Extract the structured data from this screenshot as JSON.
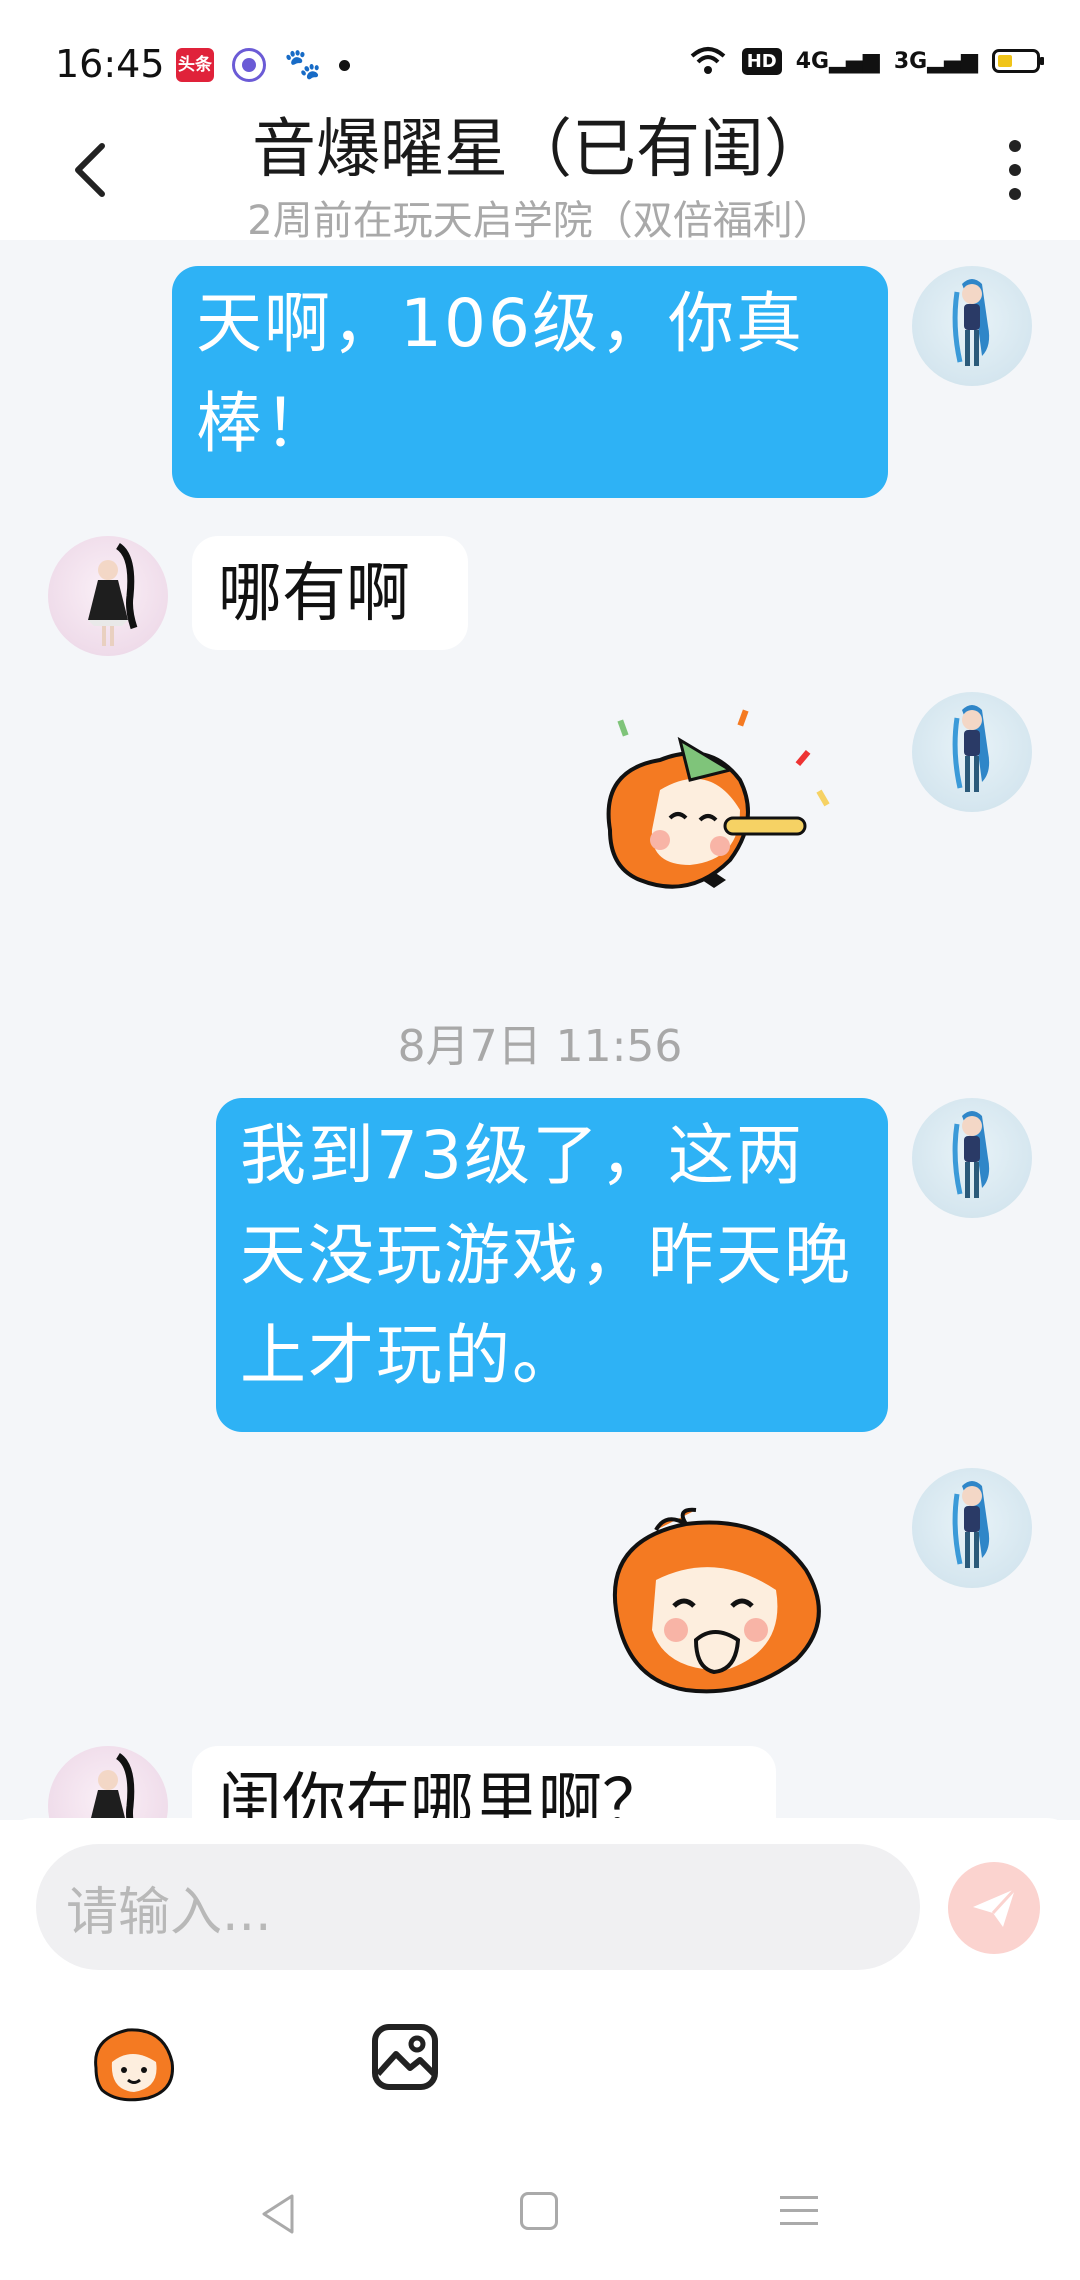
{
  "status_bar": {
    "time": "16:45",
    "app_toutiao_label": "头条",
    "net_4g": "4G",
    "net_3g": "3G",
    "hd_label": "HD",
    "battery_color": "#f0c419"
  },
  "header": {
    "title": "音爆曜星（已有闺）",
    "subtitle": "2周前在玩天启学院（双倍福利）"
  },
  "messages": [
    {
      "from": "me",
      "type": "text",
      "text": "天啊，106级，你真棒！"
    },
    {
      "from": "other",
      "type": "text",
      "text": "哪有啊"
    },
    {
      "from": "me",
      "type": "sticker",
      "sticker": "party-blower-sticker"
    },
    {
      "type": "timestamp",
      "text": "8月7日 11:56"
    },
    {
      "from": "me",
      "type": "text",
      "text": "我到73级了，这两天没玩游戏，昨天晚上才玩的。"
    },
    {
      "from": "me",
      "type": "sticker",
      "sticker": "laughing-cover-mouth-sticker"
    },
    {
      "from": "other",
      "type": "text",
      "text": "闺你在哪里啊？"
    }
  ],
  "input": {
    "placeholder": "请输入..."
  },
  "colors": {
    "my_bubble": "#2eb2f5",
    "other_bubble": "#ffffff",
    "chat_bg": "#f4f6f9",
    "send_button": "#fbd3cf"
  },
  "icons": {
    "back": "chevron-left-icon",
    "more": "more-vertical-icon",
    "send": "paper-plane-icon",
    "emoji": "mascot-emoji-icon",
    "image": "image-icon"
  }
}
